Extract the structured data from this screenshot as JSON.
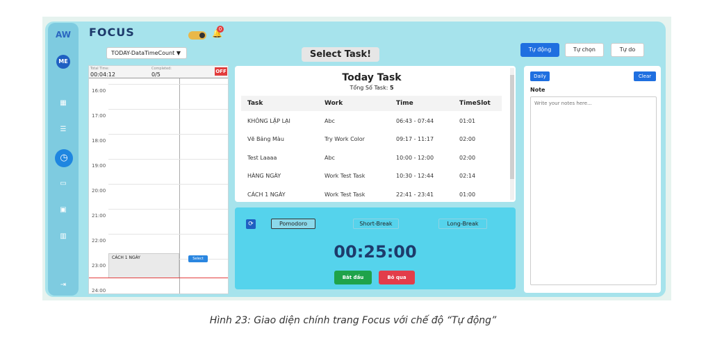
{
  "app": {
    "brand": "AW",
    "title": "FOCUS",
    "user_initials": "ME",
    "notification_count": "0"
  },
  "sidebar": {
    "items": [
      {
        "icon": "dashboard-icon",
        "glyph": "▦"
      },
      {
        "icon": "task-list-icon",
        "glyph": "☰"
      },
      {
        "icon": "clock-icon",
        "glyph": "◷"
      },
      {
        "icon": "calendar-icon",
        "glyph": "▭"
      },
      {
        "icon": "calendar-alt-icon",
        "glyph": "▣"
      },
      {
        "icon": "chart-icon",
        "glyph": "▥"
      },
      {
        "icon": "logout-icon",
        "glyph": "⇥"
      }
    ]
  },
  "schedule": {
    "dropdown_value": "TODAY-DataTimeCount ▼",
    "total_time_label": "Total Time:",
    "total_time": "00:04:12",
    "completed_label": "Completed:",
    "completed": "0/5",
    "off_label": "OFF",
    "hours": [
      "16:00",
      "17:00",
      "18:00",
      "19:00",
      "20:00",
      "21:00",
      "22:00",
      "23:00",
      "24:00"
    ],
    "event_label": "CÁCH 1 NGÀY",
    "event_select": "Select"
  },
  "select_task_label": "Select Task!",
  "task_panel": {
    "title": "Today Task",
    "subtitle_prefix": "Tổng Số Task:",
    "task_count": "5",
    "columns": [
      "Task",
      "Work",
      "Time",
      "TimeSlot"
    ],
    "rows": [
      [
        "KHÔNG LẶP LẠI",
        "Abc",
        "06:43 - 07:44",
        "01:01"
      ],
      [
        "Vẽ Bảng Màu",
        "Try Work Color",
        "09:17 - 11:17",
        "02:00"
      ],
      [
        "Test Laaaa",
        "Abc",
        "10:00 - 12:00",
        "02:00"
      ],
      [
        "HÀNG NGÀY",
        "Work Test Task",
        "10:30 - 12:44",
        "02:14"
      ],
      [
        "CÁCH 1 NGÀY",
        "Work Test Task",
        "22:41 - 23:41",
        "01:00"
      ]
    ]
  },
  "timer": {
    "modes": [
      "Pomodoro",
      "Short-Break",
      "Long-Break"
    ],
    "active_mode": "Pomodoro",
    "time": "00:25:00",
    "start_label": "Bắt đầu",
    "skip_label": "Bỏ qua"
  },
  "mode_tabs": {
    "auto": "Tự động",
    "custom": "Tự chọn",
    "free": "Tự do",
    "active": "Tự động"
  },
  "notes": {
    "daily_label": "Daily",
    "clear_label": "Clear",
    "label": "Note",
    "placeholder": "Write your notes here..."
  },
  "caption": "Hình 23: Giao diện chính trang Focus với chế độ “Tự động”",
  "colors": {
    "accent": "#1f6fe0",
    "panel_bg": "#a6e3ec",
    "timer_bg": "#55d3ec",
    "danger": "#e23d3d",
    "success": "#1fa34a"
  }
}
